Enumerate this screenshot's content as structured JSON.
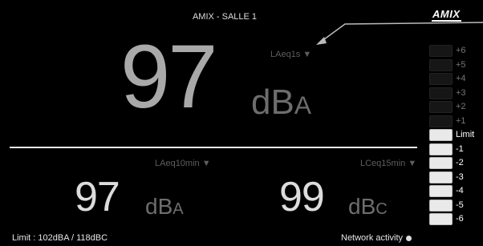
{
  "header": {
    "title": "AMIX -  SALLE 1",
    "logo_text": "AMIX"
  },
  "main_meter": {
    "selector_label": "LAeq1s ▼",
    "value": "97",
    "unit": "dB",
    "unit_suffix": "A"
  },
  "left_meter": {
    "selector_label": "LAeq10min ▼",
    "value": "97",
    "unit": "dB",
    "unit_suffix": "A"
  },
  "right_meter": {
    "selector_label": "LCeq15min ▼",
    "value": "99",
    "unit": "dB",
    "unit_suffix": "C"
  },
  "level_meter": {
    "rows": [
      {
        "label": "+6",
        "lit": false
      },
      {
        "label": "+5",
        "lit": false
      },
      {
        "label": "+4",
        "lit": false
      },
      {
        "label": "+3",
        "lit": false
      },
      {
        "label": "+2",
        "lit": false
      },
      {
        "label": "+1",
        "lit": false
      },
      {
        "label": "Limit",
        "lit": true
      },
      {
        "label": "-1",
        "lit": true
      },
      {
        "label": "-2",
        "lit": true
      },
      {
        "label": "-3",
        "lit": true
      },
      {
        "label": "-4",
        "lit": true
      },
      {
        "label": "-5",
        "lit": true
      },
      {
        "label": "-6",
        "lit": true
      }
    ]
  },
  "footer": {
    "limit_text": "Limit : 102dBA / 118dBC",
    "network_text": "Network activity"
  }
}
